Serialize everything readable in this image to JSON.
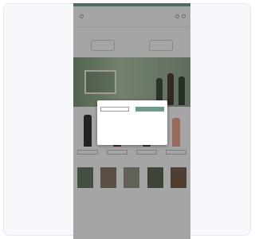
{
  "header": {
    "logo_text": ""
  },
  "nav": {
    "items": [
      "",
      "",
      "",
      "",
      ""
    ]
  },
  "promo": {
    "line1": "",
    "line2": ""
  },
  "hero": {
    "headline": ""
  },
  "sections": {
    "featured_title": "",
    "collection_title": ""
  },
  "cookie_modal": {
    "logo_text": "",
    "title": "",
    "body": "",
    "decline_label": "",
    "accept_label": "",
    "settings_link": ""
  },
  "colors": {
    "accent": "#6f9a8d",
    "brand_pink": "#e46a8a",
    "promo_red": "#c0392b"
  }
}
